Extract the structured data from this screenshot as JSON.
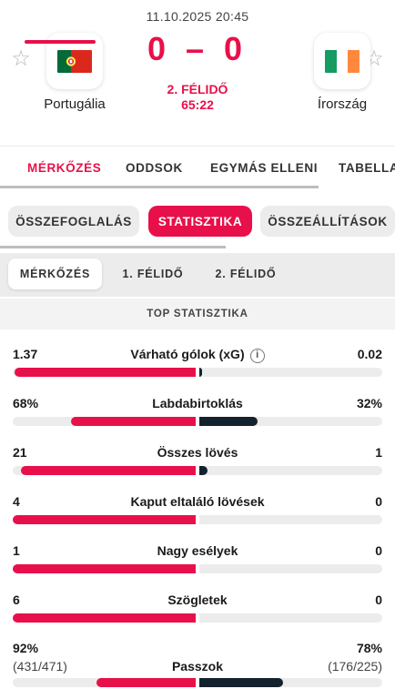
{
  "match": {
    "datetime": "11.10.2025 20:45",
    "score": "0 – 0",
    "period": "2. FÉLIDŐ",
    "clock": "65:22",
    "home": {
      "name": "Portugália",
      "flag_colors": [
        "#046a38",
        "#da291c"
      ]
    },
    "away": {
      "name": "Írország",
      "flag_colors": [
        "#169b62",
        "#ffffff",
        "#ff883e"
      ]
    }
  },
  "main_tabs": [
    "MÉRKŐZÉS",
    "ODDSOK",
    "EGYMÁS ELLENI",
    "TABELLA"
  ],
  "sub_tabs": [
    "ÖSSZEFOGLALÁS",
    "STATISZTIKA",
    "ÖSSZEÁLLÍTÁSOK"
  ],
  "period_tabs": [
    "MÉRKŐZÉS",
    "1. FÉLIDŐ",
    "2. FÉLIDŐ"
  ],
  "section_title": "TOP STATISZTIKA",
  "colors": {
    "accent": "#e8104a",
    "away_bar": "#14222e",
    "track": "#ececec"
  },
  "stats": [
    {
      "label": "Várható gólok (xG)",
      "home": "1.37",
      "away": "0.02",
      "home_share": 0.99,
      "away_share": 0.015,
      "info_icon": "info-icon"
    },
    {
      "label": "Labdabirtoklás",
      "home": "68%",
      "away": "32%",
      "home_share": 0.68,
      "away_share": 0.32
    },
    {
      "label": "Összes lövés",
      "home": "21",
      "away": "1",
      "home_share": 0.955,
      "away_share": 0.045
    },
    {
      "label": "Kaput eltaláló lövések",
      "home": "4",
      "away": "0",
      "home_share": 1.0,
      "away_share": 0.0
    },
    {
      "label": "Nagy esélyek",
      "home": "1",
      "away": "0",
      "home_share": 1.0,
      "away_share": 0.0
    },
    {
      "label": "Szögletek",
      "home": "6",
      "away": "0",
      "home_share": 1.0,
      "away_share": 0.0
    },
    {
      "label": "Passzok",
      "home": "92%",
      "away": "78%",
      "home_sub": "(431/471)",
      "away_sub": "(176/225)",
      "home_share": 0.54,
      "away_share": 0.46
    }
  ]
}
